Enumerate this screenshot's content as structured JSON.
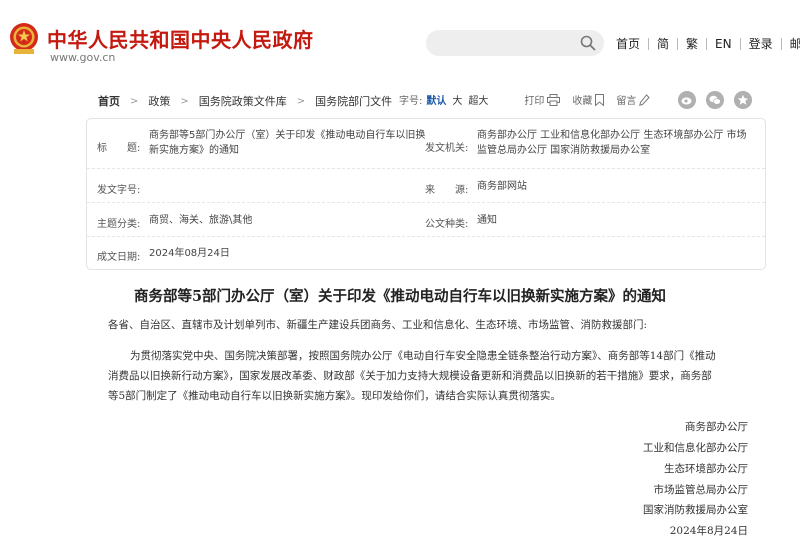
{
  "header": {
    "site_title": "中华人民共和国中央人民政府",
    "site_url": "www.gov.cn",
    "search_placeholder": "",
    "nav": [
      {
        "label": "首页"
      },
      {
        "label": "简"
      },
      {
        "label": "繁"
      },
      {
        "label": "EN"
      },
      {
        "label": "登录"
      },
      {
        "label": "邮箱"
      }
    ]
  },
  "breadcrumb": [
    "首页",
    "政策",
    "国务院政策文件库",
    "国务院部门文件"
  ],
  "tools": {
    "font_size_label": "字号:",
    "font_default": "默认",
    "font_large": "大",
    "font_xlarge": "超大",
    "print": "打印",
    "favorite": "收藏",
    "comment": "留言"
  },
  "meta": {
    "title_label": "标　　题:",
    "title_value_line1": "商务部等5部门办公厅（室）关于印发《推动电动自行车以旧换",
    "title_value_line2": "新实施方案》的通知",
    "issuer_label": "发文机关:",
    "issuer_value_line1": "商务部办公厅 工业和信息化部办公厅 生态环境部办公厅 市场",
    "issuer_value_line2": "监管总局办公厅 国家消防救援局办公室",
    "doc_no_label": "发文字号:",
    "doc_no_value": "",
    "source_label": "来　　源:",
    "source_value": "商务部网站",
    "category_label": "主题分类:",
    "category_value": "商贸、海关、旅游\\其他",
    "doctype_label": "公文种类:",
    "doctype_value": "通知",
    "date_label": "成文日期:",
    "date_value": "2024年08月24日"
  },
  "article": {
    "title": "商务部等5部门办公厅（室）关于印发《推动电动自行车以旧换新实施方案》的通知",
    "addressee": "各省、自治区、直辖市及计划单列市、新疆生产建设兵团商务、工业和信息化、生态环境、市场监管、消防救援部门:",
    "body_lines": [
      "为贯彻落实党中央、国务院决策部署，按照国务院办公厅《电动自行车安全隐患全链条整治行动方案》、商务部等14部门《推动",
      "消费品以旧换新行动方案》，国家发展改革委、财政部《关于加力支持大规模设备更新和消费品以旧换新的若干措施》要求，商务部",
      "等5部门制定了《推动电动自行车以旧换新实施方案》。现印发给你们，请结合实际认真贯彻落实。"
    ],
    "signatures": [
      "商务部办公厅",
      "工业和信息化部办公厅",
      "生态环境部办公厅",
      "市场监管总局办公厅",
      "国家消防救援局办公室",
      "2024年8月24日"
    ]
  },
  "colors": {
    "brand_red": "#c3190f",
    "accent_blue": "#1d5aa8"
  }
}
